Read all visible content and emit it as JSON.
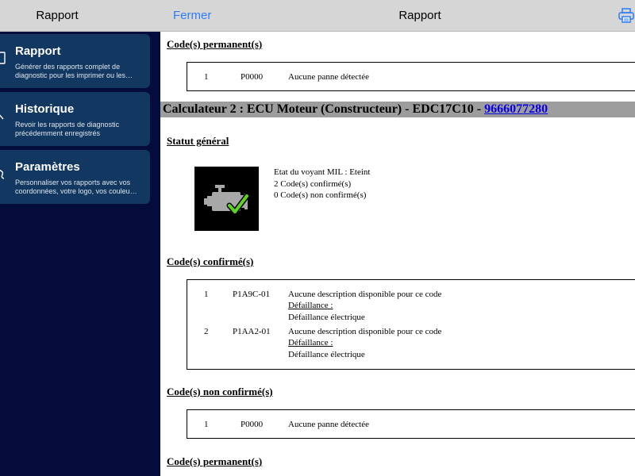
{
  "sidebar": {
    "title": "Rapport",
    "items": [
      {
        "label": "Rapport",
        "description": "Générer des rapports complet de\ndiagnostic pour les imprimer ou les…"
      },
      {
        "label": "Historique",
        "description": "Revoir les rapports de diagnostic\nprécédemment enregistrés"
      },
      {
        "label": "Paramètres",
        "description": "Personnaliser vos rapports avec vos\ncoordonnées, votre logo, vos couleu…"
      }
    ]
  },
  "header": {
    "close_label": "Fermer",
    "title": "Rapport",
    "print_icon": "printer-icon"
  },
  "report": {
    "permanent_title": "Code(s) permanent(s)",
    "permanent_codes": [
      {
        "num": "1",
        "code": "P0000",
        "description": "Aucune panne détectée"
      }
    ],
    "calculator": {
      "label": "Calculateur 2 : ECU Moteur (Constructeur) - EDC17C10 - ",
      "link": "9666077280"
    },
    "status_title": "Statut général",
    "status_icon": "engine-check-icon",
    "status_lines": [
      "Etat du voyant MIL : Eteint",
      "2 Code(s) confirmé(s)",
      "0 Code(s) non confirmé(s)"
    ],
    "confirmed_title": "Code(s) confirmé(s)",
    "confirmed_codes": [
      {
        "num": "1",
        "code": "P1A9C-01",
        "description": "Aucune description disponible pour ce code",
        "fault_label": "Défaillance :",
        "fault_value": "Défaillance électrique"
      },
      {
        "num": "2",
        "code": "P1AA2-01",
        "description": "Aucune description disponible pour ce code",
        "fault_label": "Défaillance :",
        "fault_value": "Défaillance électrique"
      }
    ],
    "unconfirmed_title": "Code(s) non confirmé(s)",
    "unconfirmed_codes": [
      {
        "num": "1",
        "code": "P0000",
        "description": "Aucune panne détectée"
      }
    ],
    "next_title_partial": "Code(s) permanent(s)"
  },
  "colors": {
    "sidebar_bg": "#040c3c",
    "card_bg": "#123760",
    "accent": "#2f7bf5",
    "link": "#0a00e6",
    "check": "#5fd12a"
  }
}
